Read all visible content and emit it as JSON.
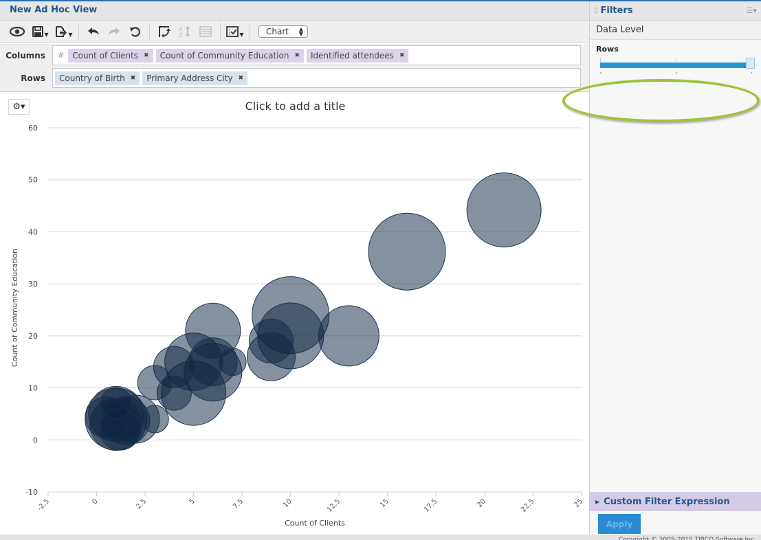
{
  "header": {
    "title": "New Ad Hoc View"
  },
  "toolbar": {
    "buttons": [
      {
        "name": "view-icon",
        "glyph": "👁"
      },
      {
        "name": "save-icon",
        "glyph": "💾"
      },
      {
        "name": "export-icon",
        "glyph": "📤"
      },
      {
        "name": "undo-icon",
        "glyph": "↶"
      },
      {
        "name": "redo-icon",
        "glyph": "↷"
      },
      {
        "name": "undo-all-icon",
        "glyph": "↺"
      },
      {
        "name": "switch-axes-icon",
        "glyph": "⟲"
      },
      {
        "name": "sort-icon",
        "glyph": "⇅"
      },
      {
        "name": "table-options-icon",
        "glyph": "▤"
      },
      {
        "name": "chart-options-icon",
        "glyph": "☑"
      }
    ],
    "view_type": "Chart"
  },
  "columns": {
    "label": "Columns",
    "hash": "#",
    "pills": [
      "Count of Clients",
      "Count of Community Education",
      "Identified attendees"
    ]
  },
  "rows": {
    "label": "Rows",
    "pills": [
      "Country of Birth",
      "Primary Address City"
    ]
  },
  "pill_remove_glyph": "✖",
  "chart_settings_glyph": "⚙▾",
  "chart_data": {
    "type": "scatter",
    "subtype": "bubble",
    "title": "Click to add a title",
    "xlabel": "Count of Clients",
    "ylabel": "Count of Community Education",
    "size_label": "Identified attendees",
    "xlim": [
      -2.5,
      25
    ],
    "ylim": [
      -10,
      60
    ],
    "x_ticks": [
      "-2.5",
      "0",
      "2.5",
      "5",
      "7.5",
      "10",
      "12.5",
      "15",
      "17.5",
      "20",
      "22.5",
      "25"
    ],
    "y_ticks": [
      "60",
      "50",
      "40",
      "30",
      "20",
      "10",
      "0",
      "-10"
    ],
    "grid": true,
    "bubble_color": "#0e2440",
    "points": [
      {
        "x": 21,
        "y": 44.2,
        "size": 54
      },
      {
        "x": 16,
        "y": 36.2,
        "size": 56
      },
      {
        "x": 10,
        "y": 24,
        "size": 56
      },
      {
        "x": 10,
        "y": 20,
        "size": 48
      },
      {
        "x": 13,
        "y": 20,
        "size": 44
      },
      {
        "x": 9,
        "y": 19,
        "size": 32
      },
      {
        "x": 9,
        "y": 16,
        "size": 35
      },
      {
        "x": 6,
        "y": 21,
        "size": 40
      },
      {
        "x": 6,
        "y": 15,
        "size": 35
      },
      {
        "x": 6,
        "y": 13,
        "size": 42
      },
      {
        "x": 5,
        "y": 15,
        "size": 42
      },
      {
        "x": 5,
        "y": 9,
        "size": 47
      },
      {
        "x": 7,
        "y": 15,
        "size": 20
      },
      {
        "x": 4,
        "y": 14,
        "size": 30
      },
      {
        "x": 4,
        "y": 9,
        "size": 25
      },
      {
        "x": 3,
        "y": 11,
        "size": 25
      },
      {
        "x": 3,
        "y": 4,
        "size": 20
      },
      {
        "x": 2,
        "y": 4,
        "size": 35
      },
      {
        "x": 1,
        "y": 7,
        "size": 23
      },
      {
        "x": 1,
        "y": 4,
        "size": 45
      },
      {
        "x": 1,
        "y": 3,
        "size": 38
      },
      {
        "x": 0.5,
        "y": 4.3,
        "size": 30
      },
      {
        "x": 1.5,
        "y": 3.7,
        "size": 35
      },
      {
        "x": 1,
        "y": 5,
        "size": 40
      },
      {
        "x": 1.2,
        "y": 2,
        "size": 30
      }
    ]
  },
  "filters": {
    "title": "Filters",
    "data_level": "Data Level",
    "rows_label": "Rows",
    "rows_slider_value": 1.0,
    "custom_filter": "Custom Filter Expression",
    "apply": "Apply"
  },
  "footer": {
    "copyright": "Copyright © 2005-2015 TIBCO Software Inc."
  }
}
